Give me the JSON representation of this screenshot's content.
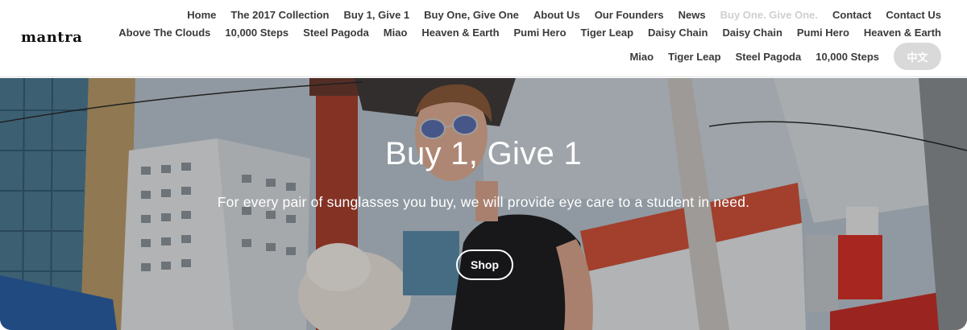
{
  "brand": {
    "logo": "mantra"
  },
  "nav": {
    "row1": [
      "Home",
      "The 2017 Collection",
      "Buy 1, Give 1",
      "Buy One, Give One",
      "About Us",
      "Our Founders",
      "News",
      "Buy One. Give One.",
      "Contact",
      "Contact Us"
    ],
    "row2": [
      "Above The Clouds",
      "10,000 Steps",
      "Steel Pagoda",
      "Miao",
      "Heaven & Earth",
      "Pumi Hero",
      "Tiger Leap",
      "Daisy Chain",
      "Daisy Chain",
      "Pumi Hero",
      "Heaven & Earth"
    ],
    "row3": [
      "Miao",
      "Tiger Leap",
      "Steel Pagoda",
      "10,000 Steps"
    ],
    "language_button": "中文"
  },
  "hero": {
    "title": "Buy 1, Give 1",
    "subtitle": "For every pair of sunglasses you buy, we will provide eye care to a student in need.",
    "cta": "Shop"
  }
}
